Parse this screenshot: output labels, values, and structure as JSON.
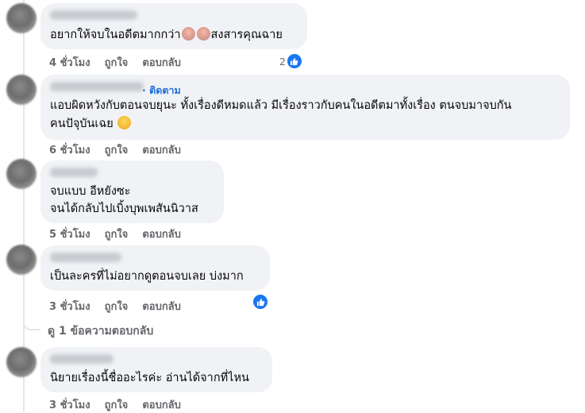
{
  "actions": {
    "like": "ถูกใจ",
    "reply": "ตอบกลับ"
  },
  "comments": [
    {
      "time": "4 ชั่วโมง",
      "lines": [
        "อยากให้จบในอดีตมากกว่า",
        "สงสารคุณฉาย"
      ],
      "reaction_count": "2"
    },
    {
      "time": "6 ชั่วโมง",
      "follow": "· ติดตาม",
      "lines": [
        "แอบผิดหวังกับตอนจบยุนะ ทั้งเรื่องดีหมดแล้ว มีเรื่องราวกับคนในอดีตมาทั้งเรื่อง ตนจบมาจบกัน",
        "คนปัจุบันเฉย"
      ]
    },
    {
      "time": "5 ชั่วโมง",
      "lines": [
        "จบแบบ อีหยังซะ",
        "จนได้กลับไปเบิ้งบุพเพสันนิวาส"
      ]
    },
    {
      "time": "3 ชั่วโมง",
      "lines": [
        "เป็นละครที่ไม่อยากดูตอนจบเลย บ่งมาก"
      ]
    },
    {
      "time": "3 ชั่วโมง",
      "lines": [
        "นิยายเรื่องนี้ชื่ออะไรค่ะ อ่านได้จากที่ไหน"
      ]
    }
  ],
  "view_replies": "ดู 1 ข้อความตอบกลับ",
  "icons": {
    "reaction": "like-thumb-icon",
    "emoji_1": "weary-face-icon",
    "emoji_2": "sad-face-icon"
  },
  "colors": {
    "bubble": "#f0f2f5",
    "link": "#216fdb",
    "like": "#1877f2",
    "meta": "#65676b"
  }
}
